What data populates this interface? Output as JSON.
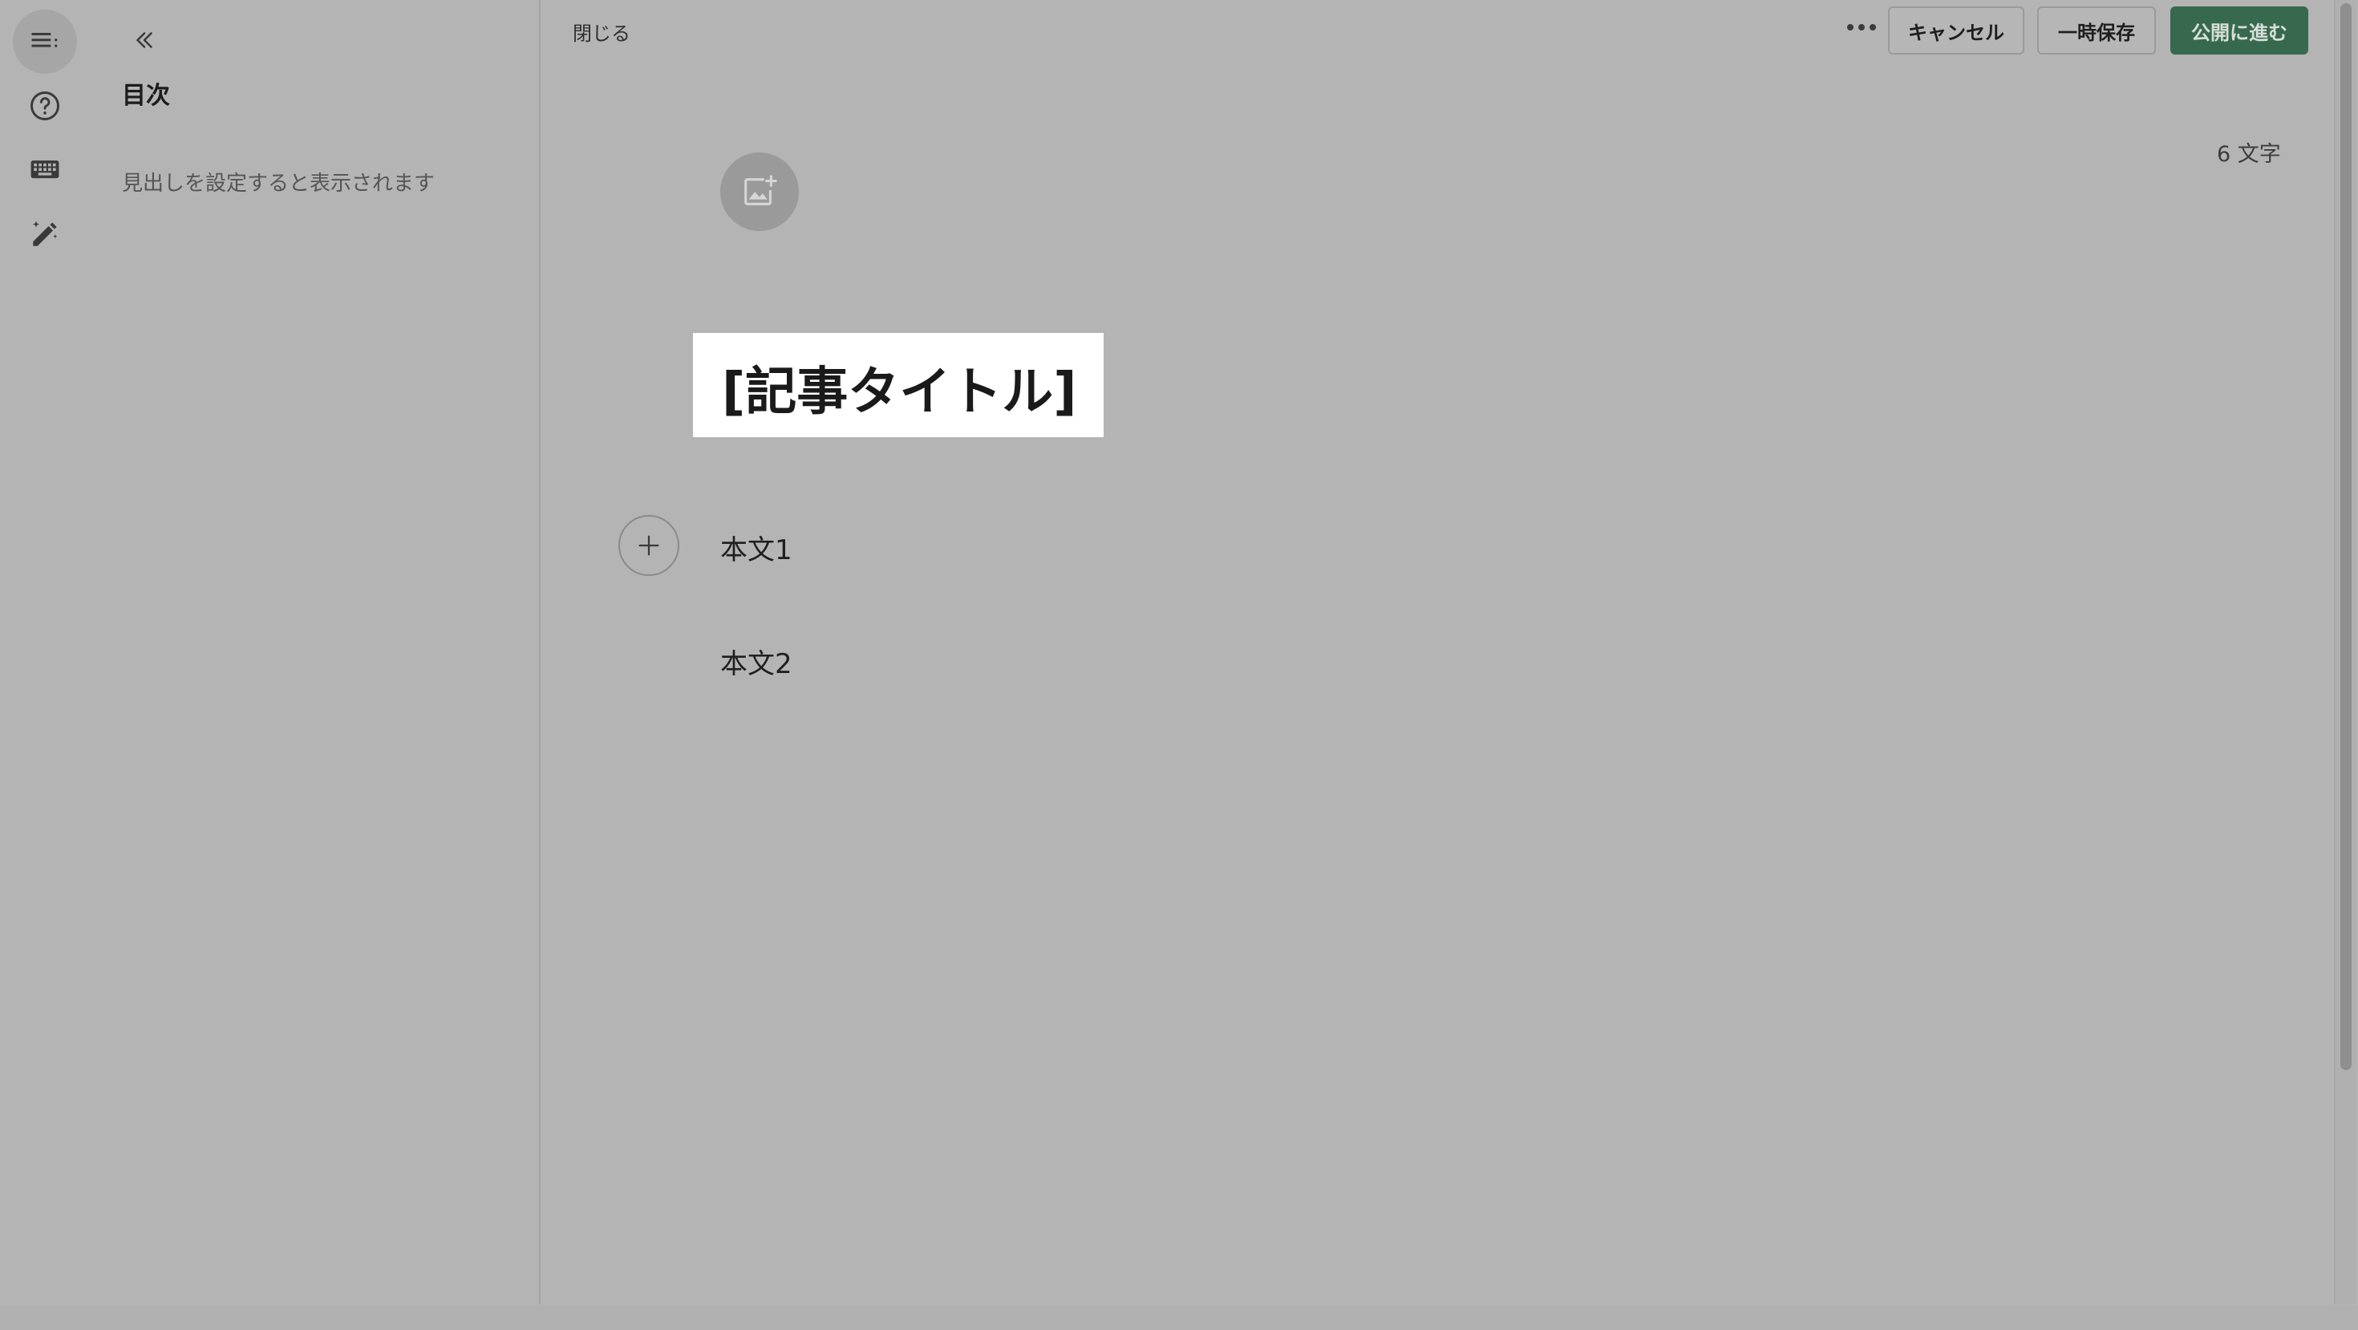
{
  "rail": {
    "items": [
      {
        "icon": "toc-list-icon",
        "active": true
      },
      {
        "icon": "help-circle-icon",
        "active": false
      },
      {
        "icon": "keyboard-icon",
        "active": false
      },
      {
        "icon": "magic-pen-icon",
        "active": false
      }
    ]
  },
  "toc": {
    "collapse_icon": "double-chevron-left-icon",
    "title": "目次",
    "empty_text": "見出しを設定すると表示されます"
  },
  "header": {
    "close_label": "閉じる",
    "more_icon": "ellipsis-icon",
    "cancel_label": "キャンセル",
    "draft_label": "一時保存",
    "publish_label": "公開に進む",
    "publish_color": "#37694f"
  },
  "editor": {
    "char_count": "6 文字",
    "image_add_icon": "image-plus-icon",
    "title": "[記事タイトル]",
    "add_block_icon": "plus-icon",
    "paragraphs": [
      "本文1",
      "本文2"
    ]
  }
}
